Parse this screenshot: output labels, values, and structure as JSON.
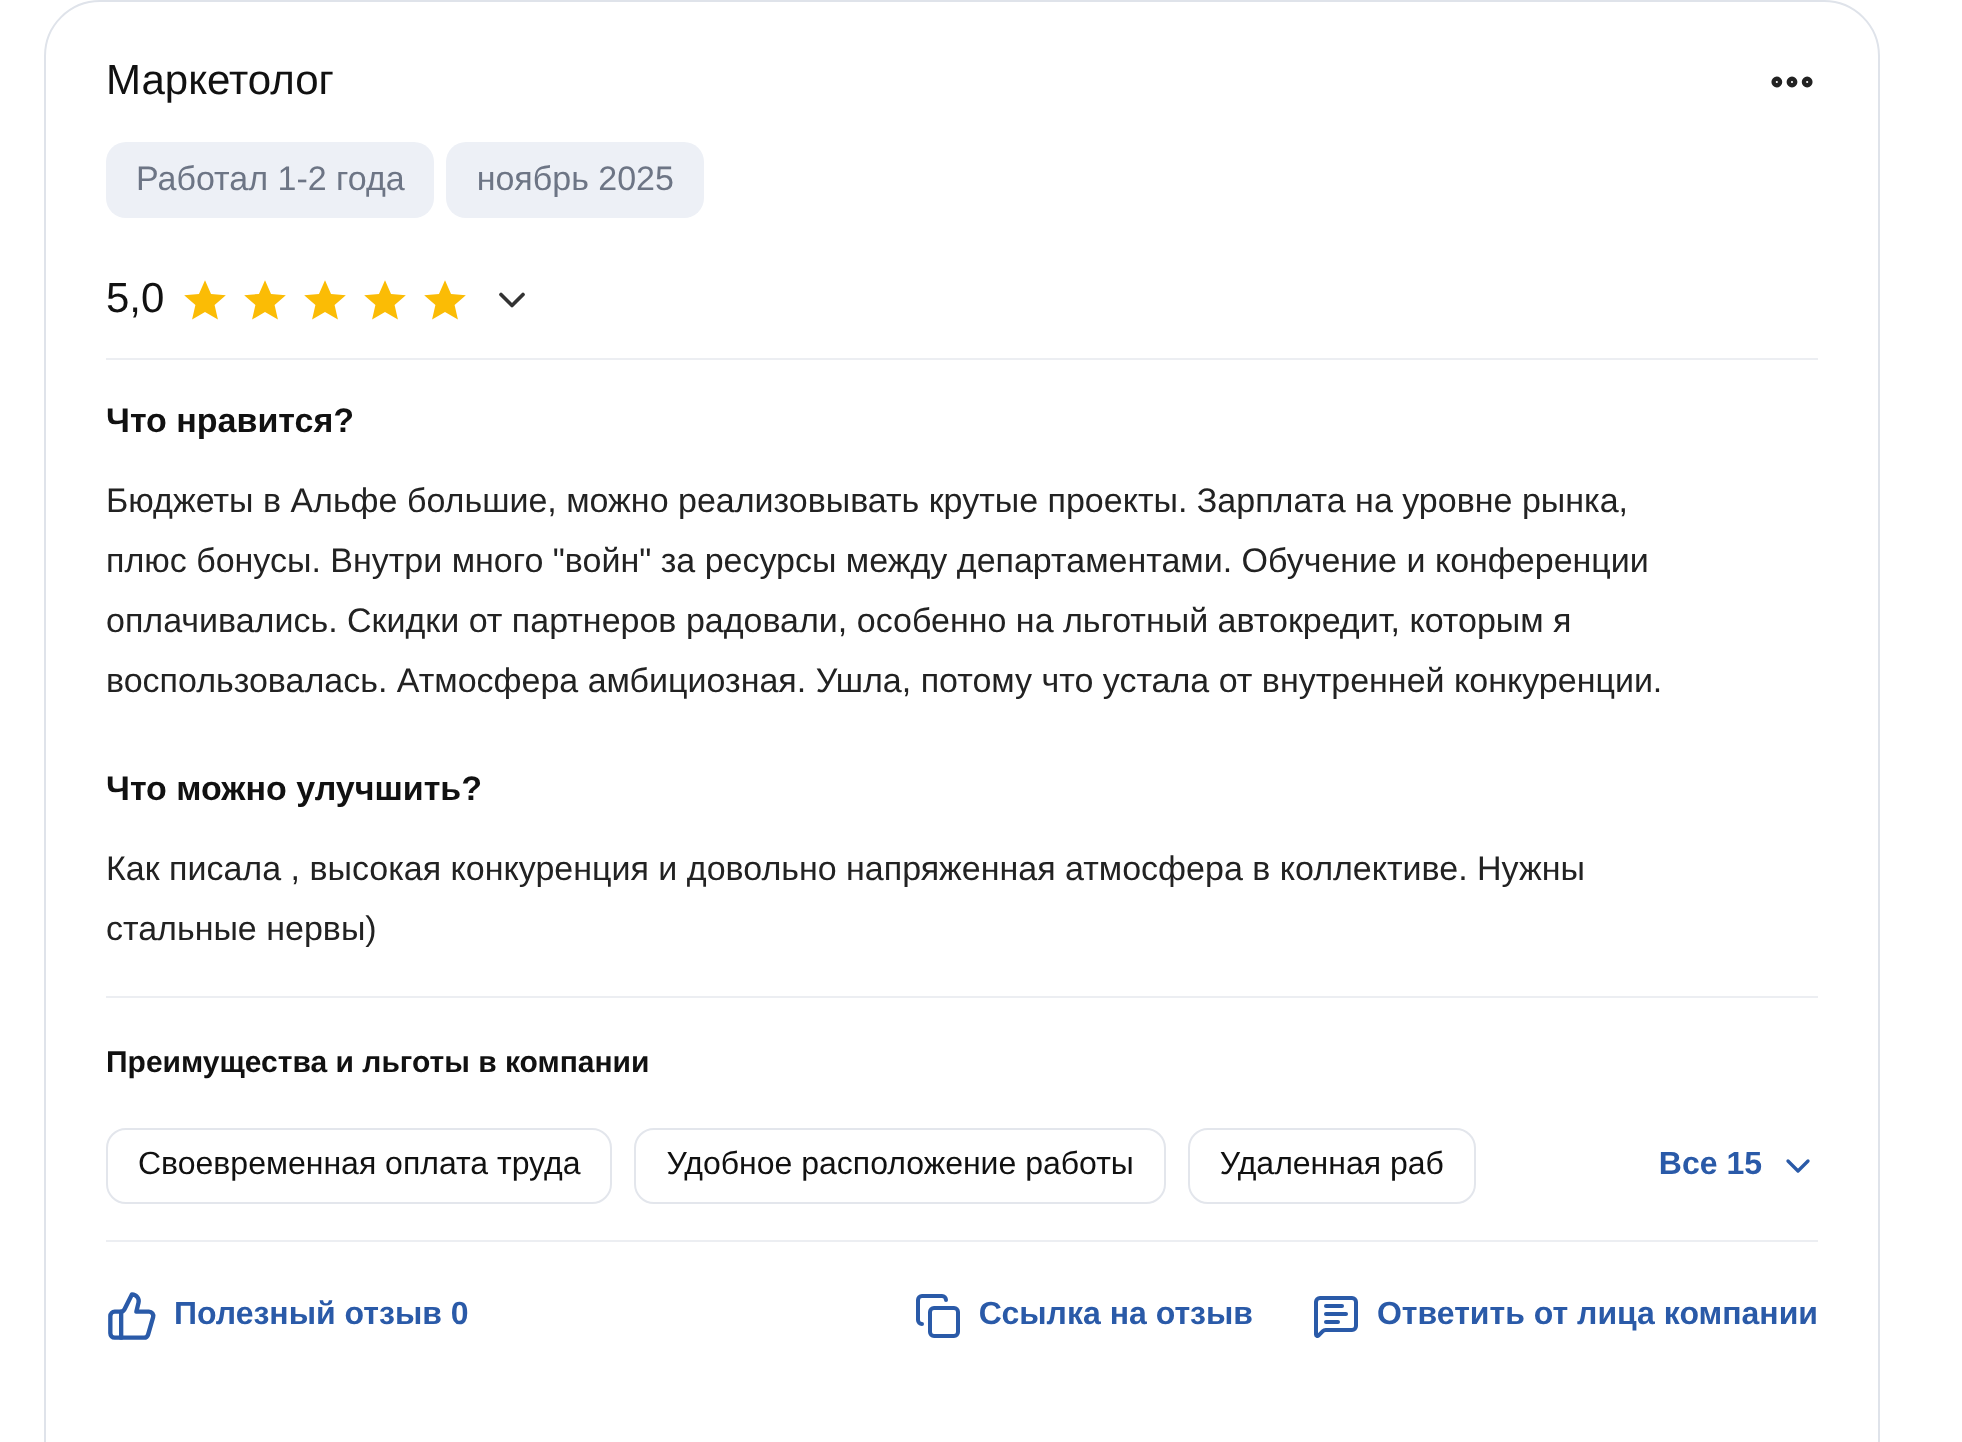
{
  "review": {
    "position": "Маркетолог",
    "tags": [
      "Работал 1-2 года",
      "ноябрь 2025"
    ],
    "rating": "5,0",
    "stars": 5,
    "sections": [
      {
        "heading": "Что нравится?",
        "text": "Бюджеты в Альфе большие, можно реализовывать крутые проекты. Зарплата на уровне рынка, плюс бонусы. Внутри много \"войн\" за ресурсы между департаментами. Обучение и конференции оплачивались. Скидки от партнеров радовали, особенно на льготный автокредит, которым я воспользовалась. Атмосфера амбициозная. Ушла, потому что устала от внутренней конкуренции."
      },
      {
        "heading": "Что можно улучшить?",
        "text": "Как писала , высокая конкуренция и довольно напряженная атмосфера в коллективе. Нужны стальные нервы)"
      }
    ],
    "benefits": {
      "heading": "Преимущества и льготы в компании",
      "items": [
        "Своевременная оплата труда",
        "Удобное расположение работы",
        "Удаленная раб"
      ],
      "more": "Все 15"
    },
    "actions": {
      "useful": "Полезный отзыв 0",
      "link": "Ссылка на отзыв",
      "reply": "Ответить от лица компании"
    }
  }
}
